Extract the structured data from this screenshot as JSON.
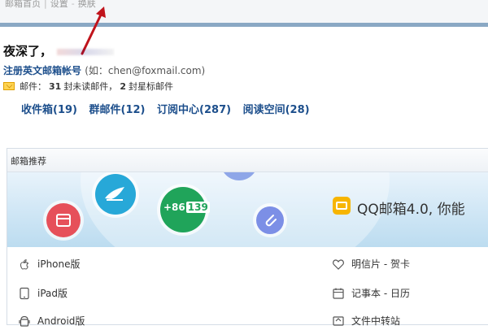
{
  "topnav": {
    "links": [
      "邮箱首页",
      "设置",
      "换肤"
    ]
  },
  "user": {
    "greeting": "夜深了，",
    "register_link": "注册英文邮箱帐号",
    "register_example": "(如：chen@foxmail.com)"
  },
  "mail_stats": {
    "mail_label": "邮件：",
    "unread_count": "31",
    "unread_label": "封未读邮件，",
    "starred_count": "2",
    "starred_label": "封星标邮件"
  },
  "folders": [
    "收件箱(19)",
    "群邮件(12)",
    "订阅中心(287)",
    "阅读空间(28)"
  ],
  "recommend": {
    "title": "邮箱推荐",
    "banner_text": "QQ邮箱4.0, 你能",
    "banner_green_prefix": "+86",
    "banner_green_number": "139"
  },
  "apps_left": [
    {
      "label": "iPhone版",
      "icon": "apple-icon"
    },
    {
      "label": "iPad版",
      "icon": "tablet-icon"
    },
    {
      "label": "Android版",
      "icon": "android-icon"
    }
  ],
  "apps_right": [
    {
      "label": "明信片 - 贺卡",
      "icon": "heart-icon"
    },
    {
      "label": "记事本 - 日历",
      "icon": "calendar-icon"
    },
    {
      "label": "文件中转站",
      "icon": "transfer-icon"
    }
  ],
  "colors": {
    "link_blue": "#1d4f8c",
    "accent_line": "#8aa8c4",
    "banner_teal": "#27a8d8",
    "banner_green": "#20a45a",
    "banner_red": "#e6505a",
    "qq_yellow": "#f7b500",
    "annotation_arrow": "#c0141c"
  }
}
